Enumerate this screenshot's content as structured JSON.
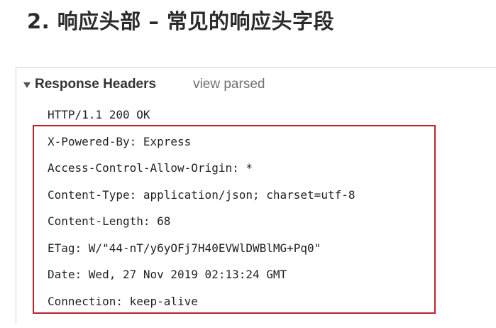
{
  "slide": {
    "title": "2. 响应头部 – 常见的响应头字段"
  },
  "response_headers": {
    "section_title": "Response Headers",
    "toggle_icon": "triangle-down-icon",
    "view_parsed_label": "view parsed",
    "status_line": "HTTP/1.1 200 OK",
    "lines": [
      "X-Powered-By: Express",
      "Access-Control-Allow-Origin: *",
      "Content-Type: application/json; charset=utf-8",
      "Content-Length: 68",
      "ETag: W/\"44-nT/y6yOFj7H40EVWlDWBlMG+Pq0\"",
      "Date: Wed, 27 Nov 2019 02:13:24 GMT",
      "Connection: keep-alive"
    ]
  },
  "colors": {
    "highlight_border": "#c0202a",
    "title_text": "#2b2b2b",
    "secondary_text": "#6f6f6f"
  }
}
